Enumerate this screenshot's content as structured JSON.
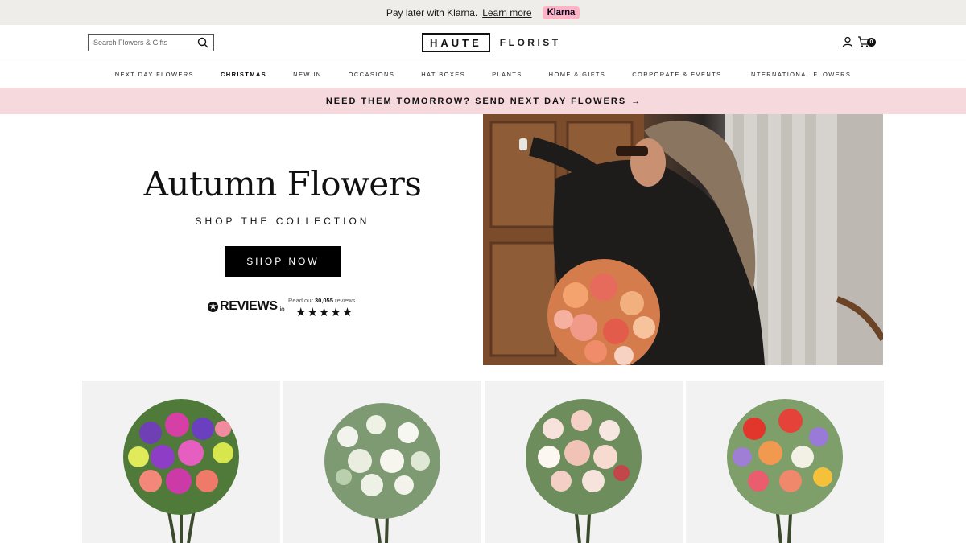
{
  "klarna": {
    "text": "Pay later with Klarna.",
    "link": "Learn more",
    "badge": "Klarna"
  },
  "header": {
    "search_placeholder": "Search Flowers & Gifts",
    "logo_left": "HAUTE",
    "logo_right": "FLORIST",
    "cart_count": "0"
  },
  "nav": {
    "items": [
      "NEXT DAY FLOWERS",
      "CHRISTMAS",
      "NEW IN",
      "OCCASIONS",
      "HAT BOXES",
      "PLANTS",
      "HOME & GIFTS",
      "CORPORATE & EVENTS",
      "INTERNATIONAL FLOWERS"
    ]
  },
  "promo": {
    "text": "NEED THEM TOMORROW? SEND NEXT DAY FLOWERS",
    "arrow": "→"
  },
  "hero": {
    "title": "Autumn Flowers",
    "subtitle": "SHOP THE COLLECTION",
    "button": "SHOP NOW",
    "reviews_brand": "REVIEWS",
    "reviews_suffix": ".io",
    "reviews_prefix": "Read our",
    "reviews_count": "30,055",
    "reviews_suffix_text": "reviews",
    "stars": "★★★★★"
  },
  "colors": {
    "promo_bg": "#f6d9dc",
    "klarna_pink": "#ffb3c7",
    "topbar_bg": "#eeede9"
  }
}
